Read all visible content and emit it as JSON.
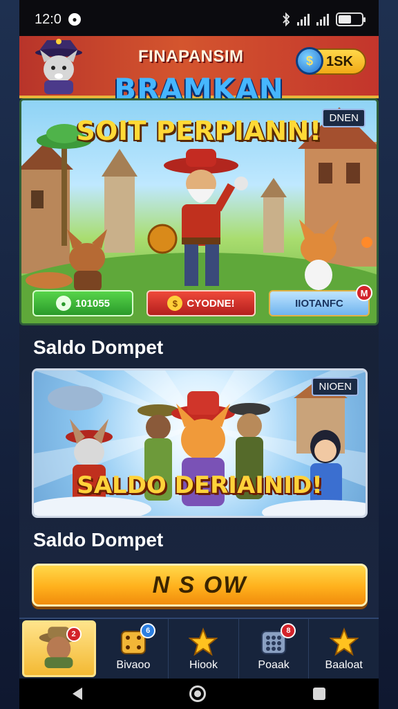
{
  "status_bar": {
    "time": "12:0",
    "notif_glyph": "●"
  },
  "header": {
    "title": "FINAPANSIM",
    "coin_label": "1SK",
    "coin_icon": "coin-icon",
    "brand": "BRAMKAN"
  },
  "hero": {
    "title": "SOIT PERPIANN!",
    "tag": "DNEN",
    "buttons": [
      {
        "label": "101055",
        "icon": "chat-icon",
        "color": "#2a9a2a"
      },
      {
        "label": "CYODNE!",
        "icon": "coin-icon",
        "color": "#b31e1e"
      },
      {
        "label": "IIOTANFC",
        "icon": "",
        "color": "#6fb4ee",
        "badge": "M"
      }
    ]
  },
  "section1": {
    "title": "Saldo Dompet"
  },
  "promo": {
    "title": "SALDO DERIAINID!",
    "tag": "NIOEN"
  },
  "section2": {
    "title": "Saldo Dompet"
  },
  "cta": {
    "label": "N S OW"
  },
  "bottom_nav": [
    {
      "label": "",
      "icon": "avatar-icon",
      "badge": "2",
      "badge_color": "red",
      "active": true
    },
    {
      "label": "Bivaoo",
      "icon": "dice-icon",
      "badge": "6",
      "badge_color": "blue",
      "active": false
    },
    {
      "label": "Hiook",
      "icon": "star-icon",
      "badge": "",
      "active": false
    },
    {
      "label": "Poaak",
      "icon": "grid-icon",
      "badge": "8",
      "badge_color": "red",
      "active": false
    },
    {
      "label": "Baaloat",
      "icon": "star-icon",
      "badge": "",
      "active": false
    }
  ],
  "colors": {
    "accent": "#f3b933",
    "header_red": "#c3352c",
    "brand_blue": "#46b6ff",
    "title_yellow": "#ffd936"
  }
}
